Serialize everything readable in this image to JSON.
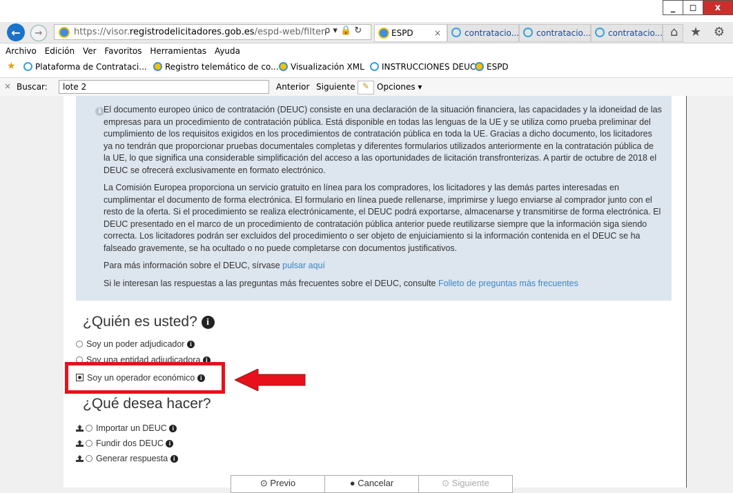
{
  "window": {
    "minimize_label": "_",
    "restore_label": "◻",
    "close_label": "x"
  },
  "addressbar": {
    "url_prefix": "https://visor.",
    "url_host": "registrodelicitadores.gob.es",
    "url_path": "/espd-web/filter",
    "controls": "ρ ▾ 🔒 ↻"
  },
  "tabs": [
    {
      "label": "ESPD",
      "active": true
    },
    {
      "label": "contratacio...",
      "active": false
    },
    {
      "label": "contratacio...",
      "active": false
    },
    {
      "label": "contratacio...",
      "active": false
    }
  ],
  "tab_close": "×",
  "right_icons": "⌂ ★ ⚙",
  "menu": [
    "Archivo",
    "Edición",
    "Ver",
    "Favoritos",
    "Herramientas",
    "Ayuda"
  ],
  "favorites": [
    {
      "label": "Plataforma de Contrataci...",
      "icon": "power-icon"
    },
    {
      "label": "Registro telemático de co...",
      "icon": "ie-icon"
    },
    {
      "label": "Visualización XML",
      "icon": "ie-icon"
    },
    {
      "label": "INSTRUCCIONES DEUC",
      "icon": "power-icon"
    },
    {
      "label": "ESPD",
      "icon": "ie-icon"
    }
  ],
  "findbar": {
    "close": "×",
    "label": "Buscar:",
    "value": "lote 2",
    "prev": "Anterior",
    "next": "Siguiente",
    "options": "Opciones ▾"
  },
  "info": {
    "icon_glyph": "i",
    "p1": "El documento europeo único de contratación (DEUC) consiste en una declaración de la situación financiera, las capacidades y la idoneidad de las empresas para un procedimiento de contratación pública. Está disponible en todas las lenguas de la UE y se utiliza como prueba preliminar del cumplimiento de los requisitos exigidos en los procedimientos de contratación pública en toda la UE. Gracias a dicho documento, los licitadores ya no tendrán que proporcionar pruebas documentales completas y diferentes formularios utilizados anteriormente en la contratación pública de la UE, lo que significa una considerable simplificación del acceso a las oportunidades de licitación transfronterizas. A partir de octubre de 2018 el DEUC se ofrecerá exclusivamente en formato electrónico.",
    "p2": "La Comisión Europea proporciona un servicio gratuito en línea para los compradores, los licitadores y las demás partes interesadas en cumplimentar el documento de forma electrónica. El formulario en línea puede rellenarse, imprimirse y luego enviarse al comprador junto con el resto de la oferta. Si el procedimiento se realiza electrónicamente, el DEUC podrá exportarse, almacenarse y transmitirse de forma electrónica. El DEUC presentado en el marco de un procedimiento de contratación pública anterior puede reutilizarse siempre que la información siga siendo correcta. Los licitadores podrán ser excluidos del procedimiento o ser objeto de enjuiciamiento si la información contenida en el DEUC se ha falseado gravemente, se ha ocultado o no puede completarse con documentos justificativos.",
    "p3_text": "Para más información sobre el DEUC, sírvase ",
    "p3_link": "pulsar aquí",
    "p4_text": "Si le interesan las respuestas a las preguntas más frecuentes sobre el DEUC, consulte ",
    "p4_link": "Folleto de preguntas más frecuentes"
  },
  "who": {
    "heading": "¿Quién es usted?",
    "options": [
      {
        "label": "Soy un poder adjudicador",
        "selected": false
      },
      {
        "label": "Soy una entidad adjudicadora",
        "selected": false
      },
      {
        "label": "Soy un operador económico",
        "selected": true
      }
    ]
  },
  "what": {
    "heading": "¿Qué desea hacer?",
    "options": [
      {
        "label": "Importar un DEUC"
      },
      {
        "label": "Fundir dos DEUC"
      },
      {
        "label": "Generar respuesta"
      }
    ]
  },
  "badge_glyph": "i",
  "buttons": {
    "prev": "⊙ Previo",
    "cancel": "● Cancelar",
    "next": "⊙ Siguiente"
  },
  "colors": {
    "highlight": "#e8101a",
    "link": "#3a87c8",
    "info_bg": "#dde5ee"
  }
}
